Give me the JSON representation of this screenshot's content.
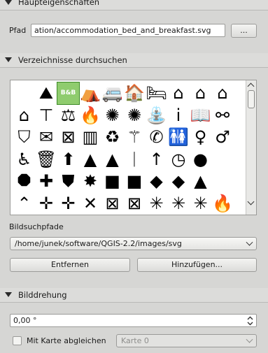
{
  "sections": {
    "main_props": {
      "title": "Haupteigenschaften"
    },
    "browse": {
      "title": "Verzeichnisse durchsuchen"
    },
    "rotation": {
      "title": "Bilddrehung"
    }
  },
  "path": {
    "label": "Pfad",
    "value": "ation/accommodation_bed_and_breakfast.svg",
    "browse_button": "..."
  },
  "icons": [
    [
      "",
      "hiker-icon",
      "bed-and-breakfast-icon",
      "camping-tent-icon",
      "caravan-icon",
      "house-bed-icon",
      "bed-icon",
      "house-icon",
      "chalet-icon",
      "shelter-icon"
    ],
    [
      "houses-icon",
      "bench-icon",
      "scales-icon",
      "fire-icon",
      "fire-station-icon",
      "fire-station-2-icon",
      "fountain-icon",
      "info-icon",
      "book-icon",
      "handcuffs-icon"
    ],
    [
      "police-badge-icon",
      "post-envelope-icon",
      "post-icon",
      "prison-icon",
      "recycling-icon",
      "survey-point-icon",
      "telephone-icon",
      "toilets-icon",
      "wc-female-icon",
      "wc-male-icon"
    ],
    [
      "wc-icon",
      "waste-basket-icon",
      "arrow-up-icon",
      "triangle-icon",
      "arrow-up-sharp-icon",
      "needle-icon",
      "arrow-up-thin-icon",
      "compass-circle-icon",
      "filled-circle-icon",
      ""
    ],
    [
      "octagon-icon",
      "cross-patch-icon",
      "shield-icon",
      "star-icon",
      "square-icon",
      "square-2-icon",
      "diamond-icon",
      "diamond-2-icon",
      "triangle-filled-icon",
      ""
    ],
    [
      "line-icon",
      "cross-dot-icon",
      "cross-green-icon",
      "x-icon",
      "x-box-icon",
      "x-red-box-icon",
      "asterisk-icon",
      "asterisk-blue-icon",
      "asterisk-red-icon",
      "flame-icon"
    ]
  ],
  "icon_glyphs": [
    [
      "",
      "⛰",
      "B&B",
      "⛺",
      "🚐",
      "🏠",
      "🛏",
      "⌂",
      "⌂",
      "⌂"
    ],
    [
      "⌂",
      "⊤",
      "⚖",
      "🔥",
      "✺",
      "✺",
      "⛲",
      "i",
      "📖",
      "⚯"
    ],
    [
      "⛉",
      "✉",
      "⊠",
      "▥",
      "♻",
      "⚚",
      "✆",
      "🚻",
      "♀",
      "♂"
    ],
    [
      "♿",
      "🗑",
      "⬆",
      "▲",
      "▲",
      "ᛁ",
      "↑",
      "◷",
      "●",
      ""
    ],
    [
      "⯃",
      "✚",
      "⛊",
      "✸",
      "■",
      "■",
      "◆",
      "◆",
      "▲",
      ""
    ],
    [
      "⌃",
      "✛",
      "✛",
      "✕",
      "⊠",
      "⊠",
      "✳",
      "✳",
      "✳",
      "🔥"
    ]
  ],
  "search_paths": {
    "label": "Bildsuchpfade",
    "selected": "/home/junek/software/QGIS-2.2/images/svg",
    "remove_button": "Entfernen",
    "add_button": "Hinzufügen..."
  },
  "rotation": {
    "value": "0,00 °",
    "sync_label": "Mit Karte abgleichen",
    "map_combo": "Karte 0"
  }
}
